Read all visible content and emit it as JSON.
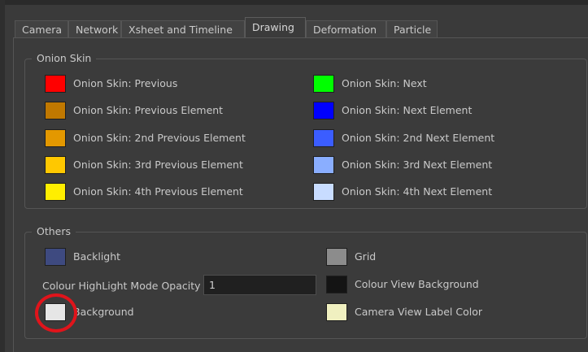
{
  "tabs": [
    "Camera",
    "Network",
    "Xsheet and Timeline",
    "Drawing",
    "Deformation",
    "Particle"
  ],
  "active_tab": "Drawing",
  "onion_skin": {
    "title": "Onion Skin",
    "left": [
      {
        "label": "Onion Skin: Previous",
        "color": "#ff0000"
      },
      {
        "label": "Onion Skin: Previous Element",
        "color": "#c07800"
      },
      {
        "label": "Onion Skin: 2nd Previous Element",
        "color": "#e39800"
      },
      {
        "label": "Onion Skin: 3rd Previous Element",
        "color": "#ffc800"
      },
      {
        "label": "Onion Skin: 4th Previous Element",
        "color": "#ffee00"
      }
    ],
    "right": [
      {
        "label": "Onion Skin: Next",
        "color": "#00ff00"
      },
      {
        "label": "Onion Skin: Next Element",
        "color": "#0000ff"
      },
      {
        "label": "Onion Skin: 2nd Next Element",
        "color": "#3b5dff"
      },
      {
        "label": "Onion Skin: 3rd Next Element",
        "color": "#8aaeff"
      },
      {
        "label": "Onion Skin: 4th Next Element",
        "color": "#c8dcff"
      }
    ]
  },
  "others": {
    "title": "Others",
    "backlight": {
      "label": "Backlight",
      "color": "#3e4a80"
    },
    "opacity_label": "Colour HighLight Mode Opacity",
    "opacity_value": "1",
    "background": {
      "label": "Background",
      "color": "#e6e6e6"
    },
    "grid": {
      "label": "Grid",
      "color": "#8c8c8c"
    },
    "colour_view_bg": {
      "label": "Colour View Background",
      "color": "#141414"
    },
    "camera_view_label": {
      "label": "Camera View Label Color",
      "color": "#f0f0c0"
    }
  },
  "annotation_color": "#e0141b"
}
